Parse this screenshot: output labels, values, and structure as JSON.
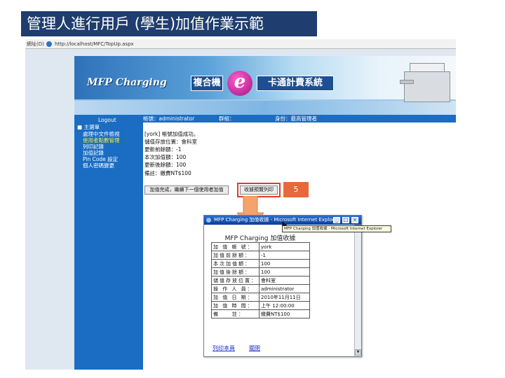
{
  "slide": {
    "title": "管理人進行用戶 (學生)加值作業示範"
  },
  "browser": {
    "address_label": "網址(D)",
    "address_url": "http://localhost/MFC/TopUp.aspx"
  },
  "banner": {
    "logo_text": "MFP Charging",
    "brand_1": "複合機",
    "brand_e": "e",
    "brand_2": "卡通計費系統"
  },
  "sidebar": {
    "logout": "Logout",
    "root": "■ 主選單",
    "items": [
      {
        "label": "處理中文件檢視",
        "active": false
      },
      {
        "label": "使用者點數管理",
        "active": true
      },
      {
        "label": "列印記錄",
        "active": false
      },
      {
        "label": "加值記錄",
        "active": false
      },
      {
        "label": "Pin Code 設定",
        "active": false
      },
      {
        "label": "個人密碼變更",
        "active": false
      }
    ]
  },
  "info_bar": {
    "account": "帳號：administrator",
    "group": "群組：",
    "role": "身份：最高管理者"
  },
  "message_lines": [
    "[york] 帳號加值成功。",
    "儲值存放位置：會科室",
    "更新前餘額：-1",
    "本次加值額：100",
    "更新後餘額：100",
    "備註：繳費NT$100"
  ],
  "buttons": {
    "continue": "加值完成，繼續下一個使用者加值",
    "print_receipt": "收據預覽列印"
  },
  "annotation": {
    "step": "5"
  },
  "popup": {
    "title": "MFP Charging 加值收據 - Microsoft Internet Explorer",
    "heading": "MFP Charging 加值收據",
    "rows": [
      {
        "key": "加 值 帳 號：",
        "value": "york"
      },
      {
        "key": "加值前餘額：",
        "value": "-1"
      },
      {
        "key": "本次加值額：",
        "value": "100"
      },
      {
        "key": "加值後餘額：",
        "value": "100"
      },
      {
        "key": "儲值存放位置：",
        "value": "會科室"
      },
      {
        "key": "操 作 人 員：",
        "value": "administrator"
      },
      {
        "key": "加 值 日 期：",
        "value": "2010年11月11日"
      },
      {
        "key": "加 值 時 間：",
        "value": "上午 12:00:00"
      },
      {
        "key": "備　　註：",
        "value": "繳費NT$100"
      }
    ],
    "print_link": "列印本頁",
    "close_link": "關閉",
    "tooltip": "MFP Charging 加值收據 - Microsoft Internet Explorer"
  },
  "colors": {
    "title_bg": "#1f3d6e",
    "sidebar_bg": "#1a6dc2",
    "highlight": "#e23a2a",
    "badge": "#e8683a",
    "arrow": "#f5a36b"
  }
}
